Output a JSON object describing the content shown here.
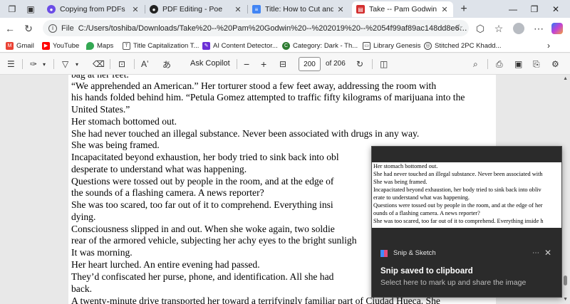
{
  "tabs": [
    {
      "title": "Copying from PDFs",
      "icon": "poe-icon",
      "active": false
    },
    {
      "title": "PDF Editing - Poe",
      "icon": "poe-icon",
      "active": false
    },
    {
      "title": "Title: How to Cut and Paste",
      "icon": "docs-icon",
      "active": false
    },
    {
      "title": "Take -- Pam Godwin -- 2019",
      "icon": "pdf-icon",
      "active": true
    }
  ],
  "address": {
    "scheme": "File",
    "url": "C:/Users/toshiba/Downloads/Take%20--%20Pam%20Godwin%20--%202019%20--%2054f99af89ac148dd8e66f1d1..."
  },
  "bookmarks": [
    {
      "label": "Gmail",
      "color": "#ea4335"
    },
    {
      "label": "YouTube",
      "color": "#ff0000"
    },
    {
      "label": "Maps",
      "color": "#34a853"
    },
    {
      "label": "Title Capitalization T...",
      "color": "#555555"
    },
    {
      "label": "AI Content Detector...",
      "color": "#6b2fd6"
    },
    {
      "label": "Category: Dark - Th...",
      "color": "#2e7d32"
    },
    {
      "label": "Library Genesis",
      "color": "#444444"
    },
    {
      "label": "Stitched 2PC Khadd...",
      "color": "#444444"
    }
  ],
  "pdf_toolbar": {
    "ask_copilot": "Ask Copilot",
    "current_page": "200",
    "total_pages": "of 206"
  },
  "document": {
    "lines": [
      "bag at her feet.",
      "     “We apprehended an American.” Her torturer stood a few feet away, addressing the room with",
      "his hands folded behind him. “Petula Gomez attempted to traffic fifty kilograms of marijuana into the",
      "United States.”",
      "     Her stomach bottomed out.",
      "     She had never touched an illegal substance. Never been associated with drugs in any way.",
      "     She was being framed.",
      "     Incapacitated beyond exhaustion, her body tried to sink back into obl",
      "desperate to understand what was happening.",
      "     Questions were tossed out by people in the room, and at the edge of",
      "the sounds of a flashing camera. A news reporter?",
      "     She was too scared, too far out of it to comprehend. Everything insi",
      "dying.",
      "     Consciousness slipped in and out. When she woke again, two soldie",
      "rear of the armored vehicle, subjecting her achy eyes to the bright sunligh",
      "     It was morning.",
      "     Her heart lurched. An entire evening had passed.",
      "     They’d confiscated her purse, phone, and identification. All she had",
      "back.",
      "     A twenty-minute drive transported her toward a terrifyingly familiar part of Ciudad Hueca. She"
    ]
  },
  "notification": {
    "app_name": "Snip & Sketch",
    "title": "Snip saved to clipboard",
    "body": "Select here to mark up and share the image",
    "preview_lines": [
      "Her stomach bottomed out.",
      "She had never touched an illegal substance. Never been associated with",
      "She was being framed.",
      "Incapacitated beyond exhaustion, her body tried to sink back into obliv",
      "erate to understand what was happening.",
      "Questions were tossed out by people in the room, and at the edge of her",
      "ounds of a flashing camera. A news reporter?",
      "She was too scared, too far out of it to comprehend. Everything inside h"
    ]
  }
}
